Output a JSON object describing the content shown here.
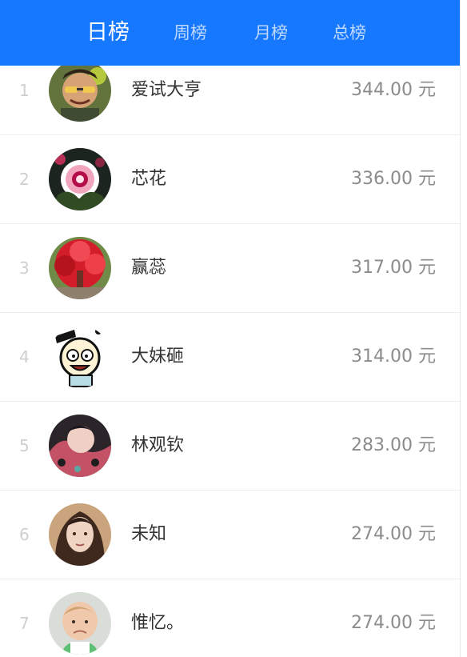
{
  "header": {
    "tabs": [
      {
        "label": "日榜",
        "active": true
      },
      {
        "label": "周榜",
        "active": false
      },
      {
        "label": "月榜",
        "active": false
      },
      {
        "label": "总榜",
        "active": false
      }
    ],
    "accent_color": "#1677ff"
  },
  "leaderboard": {
    "unit": "元",
    "items": [
      {
        "rank": "1",
        "name": "爱试大亨",
        "amount": "344.00 元",
        "avatar_icon": "avatar-cartoon-man-icon"
      },
      {
        "rank": "2",
        "name": "芯花",
        "amount": "336.00 元",
        "avatar_icon": "avatar-flower-icon"
      },
      {
        "rank": "3",
        "name": "赢蕊",
        "amount": "317.00 元",
        "avatar_icon": "avatar-red-tree-icon"
      },
      {
        "rank": "4",
        "name": "大妹砸",
        "amount": "314.00 元",
        "avatar_icon": "avatar-cartoon-face-icon"
      },
      {
        "rank": "5",
        "name": "林观钦",
        "amount": "283.00 元",
        "avatar_icon": "avatar-child-icon"
      },
      {
        "rank": "6",
        "name": "未知",
        "amount": "274.00 元",
        "avatar_icon": "avatar-woman-icon"
      },
      {
        "rank": "7",
        "name": "惟忆。",
        "amount": "274.00 元",
        "avatar_icon": "avatar-baby-icon"
      }
    ]
  }
}
